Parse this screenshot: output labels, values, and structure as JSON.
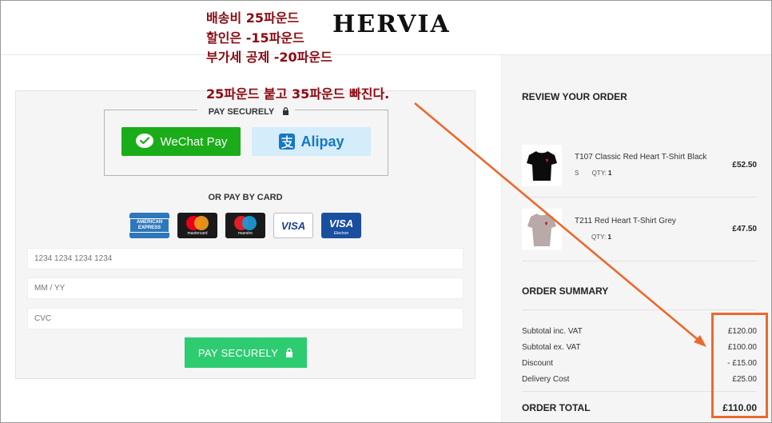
{
  "brand": {
    "logo": "HERVIA"
  },
  "annotation": {
    "lines": [
      "배송비 25파운드",
      "할인은 -15파운드",
      "부가세 공제 -20파운드",
      "25파운드 붙고 35파운드 빠진다."
    ],
    "color": "#8b0a12",
    "arrow_color": "#ea6a2c"
  },
  "payment": {
    "secure_label": "PAY SECURELY",
    "wechat_label": "WeChat Pay",
    "alipay_label": "Alipay",
    "or_card_label": "OR PAY BY CARD",
    "cards": [
      {
        "icon": "amex-card-icon",
        "label": "AMERICAN EXPRESS"
      },
      {
        "icon": "mastercard-icon",
        "label": "mastercard"
      },
      {
        "icon": "maestro-icon",
        "label": "maestro"
      },
      {
        "icon": "visa-icon",
        "label": "VISA"
      },
      {
        "icon": "visa-electron-icon",
        "label": "VISA",
        "sub": "Electron"
      }
    ],
    "card_number_placeholder": "1234 1234 1234 1234",
    "expiry_placeholder": "MM / YY",
    "cvc_placeholder": "CVC",
    "pay_button": "PAY SECURELY",
    "button_color": "#2ecc71"
  },
  "review": {
    "title": "REVIEW YOUR ORDER",
    "items": [
      {
        "name": "T107 Classic Red Heart T-Shirt Black",
        "size": "S",
        "qty_label": "QTY:",
        "qty": "1",
        "price": "£52.50"
      },
      {
        "name": "T211 Red Heart T-Shirt Grey",
        "size": "",
        "qty_label": "QTY:",
        "qty": "1",
        "price": "£47.50"
      }
    ]
  },
  "summary": {
    "title": "ORDER SUMMARY",
    "rows": [
      {
        "label": "Subtotal inc. VAT",
        "value": "£120.00"
      },
      {
        "label": "Subtotal ex. VAT",
        "value": "£100.00"
      },
      {
        "label": "Discount",
        "value": "- £15.00"
      },
      {
        "label": "Delivery Cost",
        "value": "£25.00"
      }
    ],
    "total_label": "ORDER TOTAL",
    "total_value": "£110.00"
  }
}
